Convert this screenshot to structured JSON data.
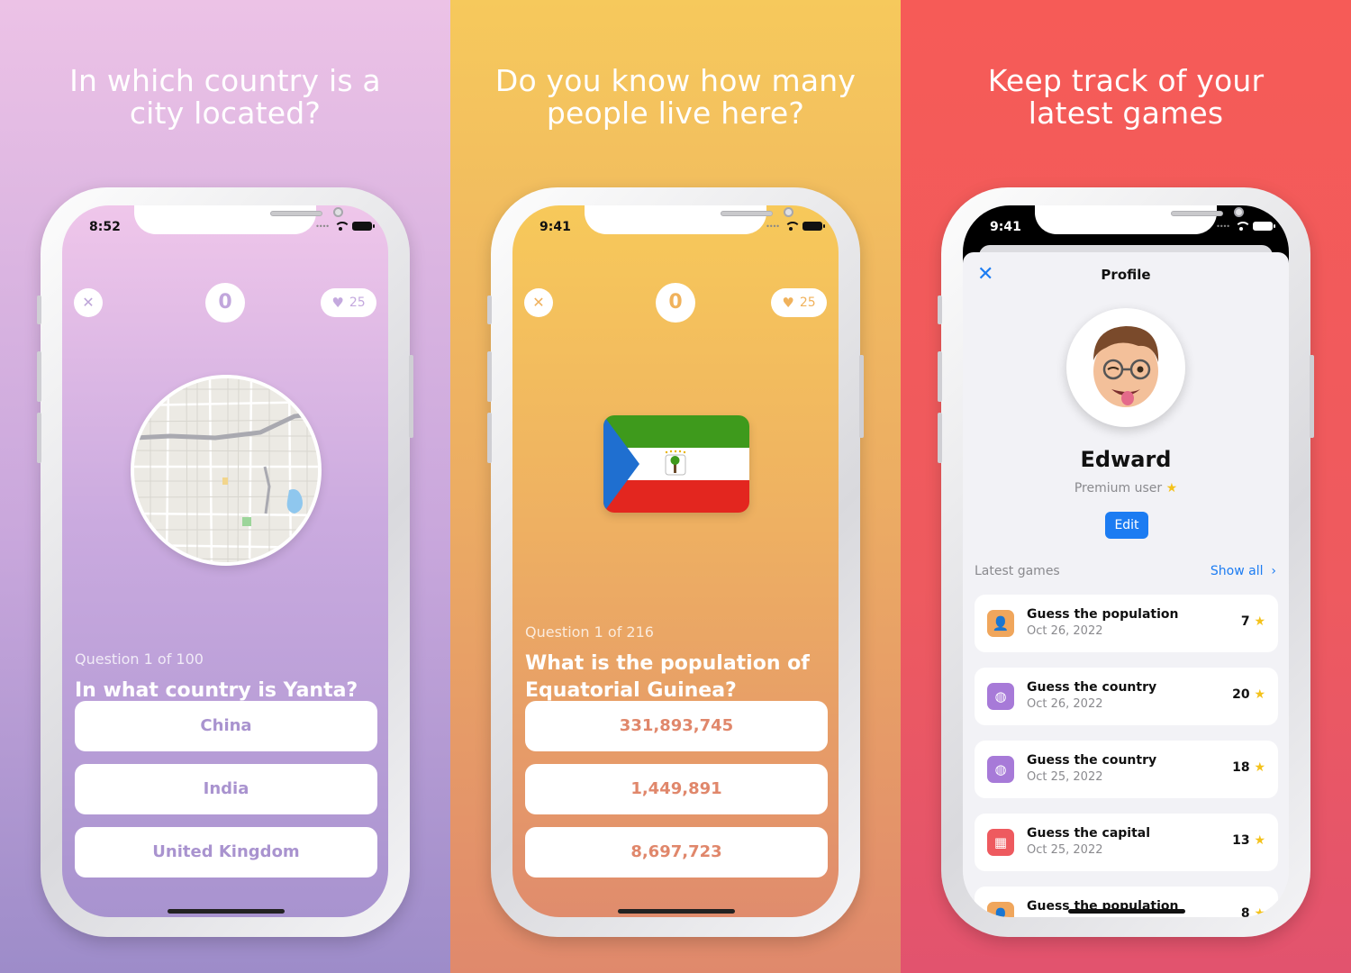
{
  "panels": [
    {
      "headline_line1": "In which country is a",
      "headline_line2": "city located?",
      "status_time": "8:52",
      "score": "0",
      "lives": "25",
      "close_icon": "close-icon",
      "question_number": "Question 1 of 100",
      "question": "In what country is Yanta?",
      "answers": [
        "China",
        "India",
        "United Kingdom"
      ]
    },
    {
      "headline_line1": "Do you know how many",
      "headline_line2": "people live here?",
      "status_time": "9:41",
      "score": "0",
      "lives": "25",
      "question_number": "Question 1 of 216",
      "question_line1": "What is the population of",
      "question_line2": "Equatorial Guinea?",
      "answers": [
        "331,893,745",
        "1,449,891",
        "8,697,723"
      ]
    },
    {
      "headline_line1": "Keep track of your",
      "headline_line2": "latest games",
      "status_time": "9:41",
      "profile": {
        "title": "Profile",
        "name": "Edward",
        "subtitle": "Premium user",
        "edit_label": "Edit",
        "latest_label": "Latest games",
        "show_all": "Show all",
        "games": [
          {
            "name": "Guess the population",
            "date": "Oct 26, 2022",
            "score": "7",
            "icon": "person-icon",
            "color": "#f0a65c"
          },
          {
            "name": "Guess the country",
            "date": "Oct 26, 2022",
            "score": "20",
            "icon": "globe-icon",
            "color": "#a77ad8"
          },
          {
            "name": "Guess the country",
            "date": "Oct 25, 2022",
            "score": "18",
            "icon": "globe-icon",
            "color": "#a77ad8"
          },
          {
            "name": "Guess the capital",
            "date": "Oct 25, 2022",
            "score": "13",
            "icon": "building-icon",
            "color": "#ee5a5f"
          },
          {
            "name": "Guess the population",
            "date": "",
            "score": "8",
            "icon": "person-icon",
            "color": "#f0a65c"
          }
        ]
      }
    }
  ],
  "colors": {
    "purple_accent": "#a993cf",
    "orange_accent": "#e0876b",
    "blue_link": "#1c7cf2",
    "star": "#f4c21b"
  }
}
